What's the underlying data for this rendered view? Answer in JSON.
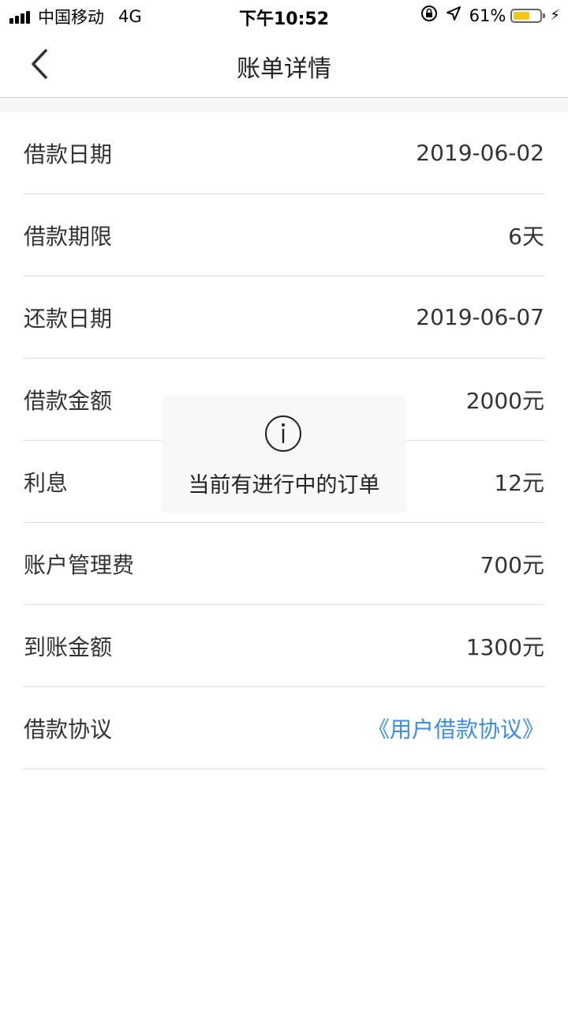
{
  "status_bar": {
    "carrier": "中国移动",
    "network": "4G",
    "time": "下午10:52",
    "battery_percent": "61%",
    "battery_level": 0.61,
    "battery_color": "#f7c51a"
  },
  "header": {
    "title": "账单详情",
    "back_icon": "chevron-left-icon"
  },
  "details": [
    {
      "label": "借款日期",
      "value": "2019-06-02"
    },
    {
      "label": "借款期限",
      "value": "6天"
    },
    {
      "label": "还款日期",
      "value": "2019-06-07"
    },
    {
      "label": "借款金额",
      "value": "2000元"
    },
    {
      "label": "利息",
      "value": "12元"
    },
    {
      "label": "账户管理费",
      "value": "700元"
    },
    {
      "label": "到账金额",
      "value": "1300元"
    },
    {
      "label": "借款协议",
      "value": "《用户借款协议》"
    }
  ],
  "toast": {
    "icon": "info-icon",
    "message": "当前有进行中的订单"
  },
  "colors": {
    "link": "#3a8ee6",
    "divider": "#dddddd",
    "text": "#333333"
  }
}
